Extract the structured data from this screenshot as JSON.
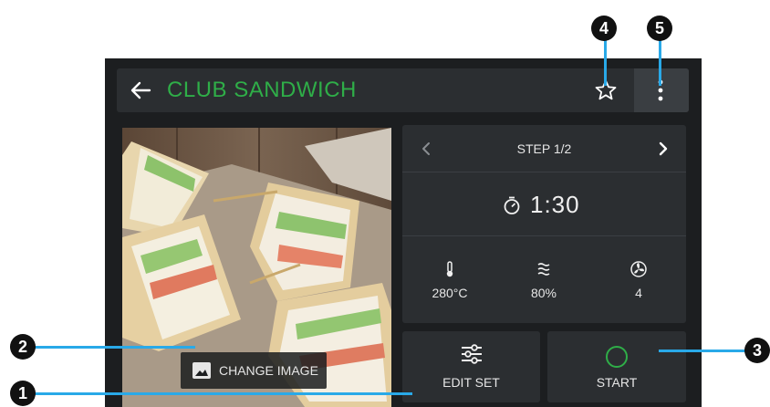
{
  "header": {
    "title": "CLUB SANDWICH"
  },
  "image_panel": {
    "change_image_label": "CHANGE IMAGE"
  },
  "step_panel": {
    "step_label": "STEP 1/2",
    "timer": "1:30",
    "params": [
      {
        "name": "temperature",
        "value": "280°C",
        "icon": "thermometer-icon"
      },
      {
        "name": "humidity",
        "value": "80%",
        "icon": "steam-icon"
      },
      {
        "name": "fan",
        "value": "4",
        "icon": "fan-icon"
      }
    ]
  },
  "actions": {
    "edit_set_label": "EDIT SET",
    "start_label": "START"
  },
  "callouts": [
    "1",
    "2",
    "3",
    "4",
    "5"
  ],
  "colors": {
    "accent": "#2fae48",
    "callout_line": "#29a9e8"
  }
}
